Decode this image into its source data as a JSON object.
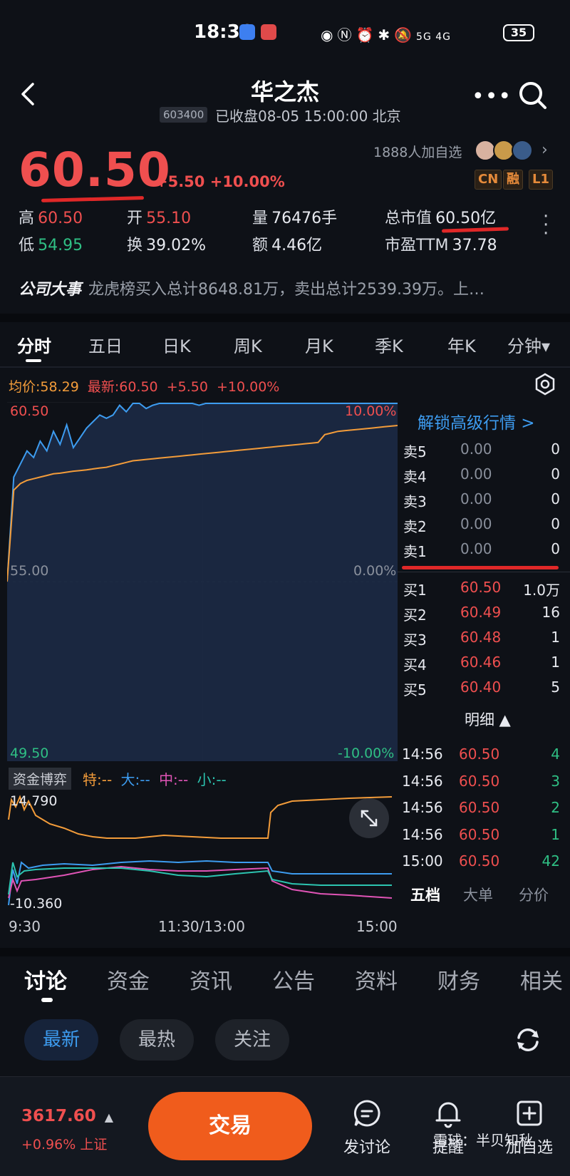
{
  "status_bar": {
    "time": "18:36",
    "battery": "35",
    "network": "5G 4G"
  },
  "header": {
    "stock_name": "华之杰",
    "stock_code": "603400",
    "status": "已收盘08-05 15:00:00 北京"
  },
  "quote": {
    "last_price": "60.50",
    "change": "+5.50 +10.00%",
    "follow_count": "1888人加自选",
    "tags": [
      "CN",
      "融",
      "L1"
    ],
    "high_label": "高",
    "high": "60.50",
    "open_label": "开",
    "open": "55.10",
    "volume_label": "量",
    "volume": "76476手",
    "mktcap_label": "总市值",
    "mktcap": "60.50亿",
    "low_label": "低",
    "low": "54.95",
    "turnover_label": "换",
    "turnover": "39.02%",
    "amount_label": "额",
    "amount": "4.46亿",
    "pe_label": "市盈TTM",
    "pe": "37.78"
  },
  "events": {
    "title": "公司大事",
    "text": "龙虎榜买入总计8648.81万，卖出总计2539.39万。上…"
  },
  "chart_tabs": [
    "分时",
    "五日",
    "日K",
    "周K",
    "月K",
    "季K",
    "年K",
    "分钟▾"
  ],
  "chart_info": {
    "avg": "均价:58.29",
    "latest": "最新:60.50",
    "change": "+5.50",
    "pct": "+10.00%"
  },
  "chart_labels": {
    "top_price": "60.50",
    "top_pct": "10.00%",
    "mid_price": "55.00",
    "mid_pct": "0.00%",
    "bottom_price": "49.50",
    "bottom_pct": "-10.00%"
  },
  "order_book": {
    "unlock": "解锁高级行情 >",
    "sells": [
      {
        "label": "卖5",
        "price": "0.00",
        "vol": "0"
      },
      {
        "label": "卖4",
        "price": "0.00",
        "vol": "0"
      },
      {
        "label": "卖3",
        "price": "0.00",
        "vol": "0"
      },
      {
        "label": "卖2",
        "price": "0.00",
        "vol": "0"
      },
      {
        "label": "卖1",
        "price": "0.00",
        "vol": "0"
      }
    ],
    "buys": [
      {
        "label": "买1",
        "price": "60.50",
        "vol": "1.0万"
      },
      {
        "label": "买2",
        "price": "60.49",
        "vol": "16"
      },
      {
        "label": "买3",
        "price": "60.48",
        "vol": "1"
      },
      {
        "label": "买4",
        "price": "60.46",
        "vol": "1"
      },
      {
        "label": "买5",
        "price": "60.40",
        "vol": "5"
      }
    ],
    "detail_title": "明细 ▲",
    "ticks": [
      {
        "time": "14:56",
        "price": "60.50",
        "vol": "4",
        "side": "green"
      },
      {
        "time": "14:56",
        "price": "60.50",
        "vol": "3",
        "side": "green"
      },
      {
        "time": "14:56",
        "price": "60.50",
        "vol": "2",
        "side": "green"
      },
      {
        "time": "14:56",
        "price": "60.50",
        "vol": "1",
        "side": "green"
      },
      {
        "time": "15:00",
        "price": "60.50",
        "vol": "42",
        "side": "green"
      }
    ],
    "tabs": [
      "五档",
      "大单",
      "分价"
    ]
  },
  "fund_flow": {
    "label": "资金博弈",
    "legend": [
      {
        "text": "特:--",
        "color": "#f39c3a"
      },
      {
        "text": "大:--",
        "color": "#3d9cf0"
      },
      {
        "text": "中:--",
        "color": "#e054b6"
      },
      {
        "text": "小:--",
        "color": "#2cc4b0"
      }
    ],
    "top_value": "14.790",
    "bottom_value": "-10.360"
  },
  "time_axis": [
    "9:30",
    "11:30/13:00",
    "15:00"
  ],
  "bottom_tabs": [
    "讨论",
    "资金",
    "资讯",
    "公告",
    "资料",
    "财务",
    "相关"
  ],
  "filter_chips": [
    "最新",
    "最热",
    "关注"
  ],
  "footer": {
    "index_price": "3617.60",
    "index_arrow": "▲",
    "index_change": "+0.96% 上证",
    "trade": "交易",
    "buttons": [
      "发讨论",
      "提醒",
      "加自选"
    ],
    "watermark": "雪球：半贝知秋"
  },
  "colors": {
    "up": "#ef4f4f",
    "down": "#2fbf84",
    "accent": "#f05c1c",
    "link": "#3d9cf0",
    "avg_line": "#f39c3a"
  },
  "chart_data": {
    "type": "line",
    "series": [
      {
        "values": [
          55.0,
          58.2,
          58.6,
          59.0,
          58.8,
          59.3,
          59.0,
          59.6,
          59.2,
          59.8,
          59.1,
          59.4,
          59.7,
          59.9,
          60.1,
          60.0,
          60.1,
          60.4,
          60.2,
          60.6,
          60.9,
          60.3,
          60.4,
          60.6,
          60.9,
          60.5,
          60.6,
          60.7,
          60.5,
          60.4,
          60.5,
          60.9,
          61.2,
          61.1,
          60.8,
          60.9,
          60.7,
          61.0,
          60.8,
          61.0,
          61.2,
          60.9,
          61.1,
          60.8,
          61.2,
          61.0,
          61.1,
          61.2,
          60.5,
          60.5,
          60.5,
          60.5,
          60.5,
          60.5,
          60.5,
          60.5,
          60.5,
          60.5,
          60.5,
          60.5
        ]
      },
      {
        "values": [
          55.0,
          57.8,
          58.0,
          58.1,
          58.15,
          58.2,
          58.25,
          58.3,
          58.32,
          58.35,
          58.38,
          58.4,
          58.42,
          58.45,
          58.48,
          58.5,
          58.55,
          58.6,
          58.65,
          58.7,
          58.72,
          58.74,
          58.76,
          58.78,
          58.8,
          58.82,
          58.84,
          58.86,
          58.88,
          58.9,
          58.92,
          58.94,
          58.96,
          58.98,
          59.0,
          59.02,
          59.04,
          59.06,
          59.08,
          59.1,
          59.12,
          59.14,
          59.16,
          59.18,
          59.2,
          59.22,
          59.24,
          59.26,
          59.5,
          59.55,
          59.6,
          59.62,
          59.64,
          59.66,
          59.68,
          59.7,
          59.72,
          59.74,
          59.76,
          59.78
        ]
      }
    ],
    "ylim": [
      49.5,
      60.5
    ]
  }
}
